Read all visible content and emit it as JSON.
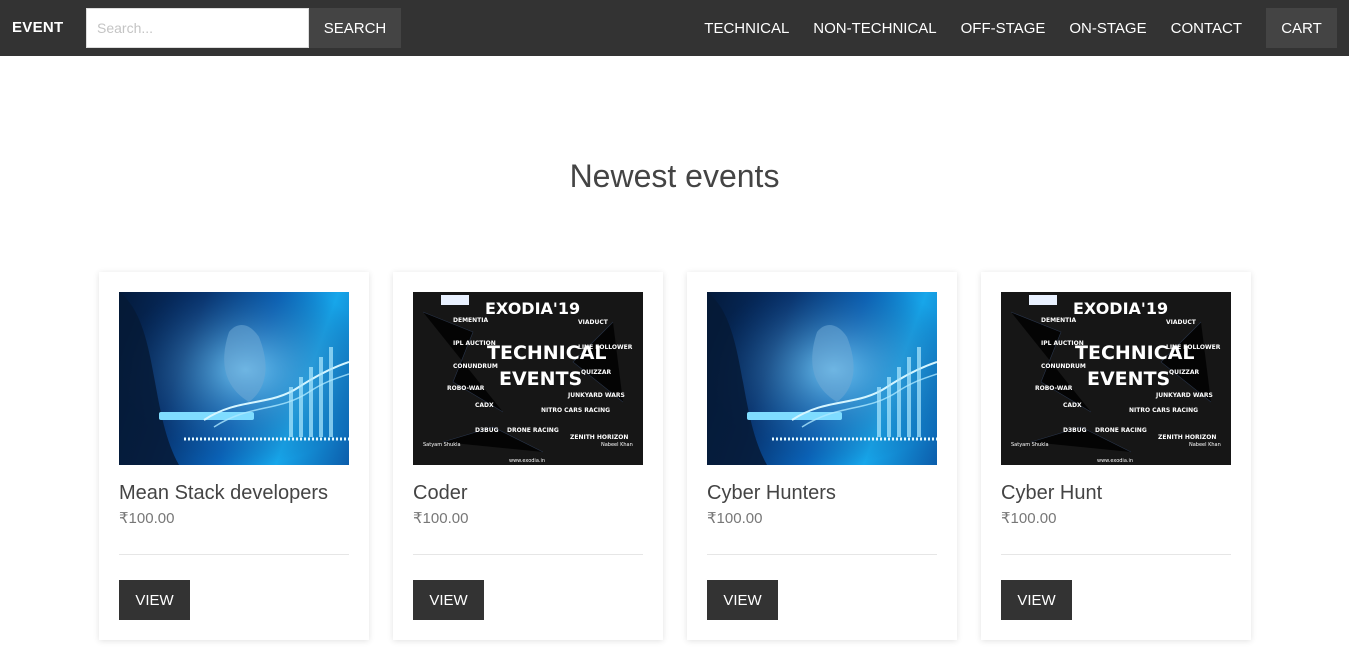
{
  "navbar": {
    "brand": "EVENT",
    "search": {
      "placeholder": "Search...",
      "value": "",
      "button_label": "SEARCH"
    },
    "links": [
      "TECHNICAL",
      "NON-TECHNICAL",
      "OFF-STAGE",
      "ON-STAGE",
      "CONTACT"
    ],
    "cart_label": "CART"
  },
  "main": {
    "title": "Newest events",
    "events": [
      {
        "title": "Mean Stack developers",
        "price": "₹100.00",
        "image": "cyber-tech-image",
        "button_label": "VIEW"
      },
      {
        "title": "Coder",
        "price": "₹100.00",
        "image": "exodia-poster-image",
        "button_label": "VIEW"
      },
      {
        "title": "Cyber Hunters",
        "price": "₹100.00",
        "image": "cyber-tech-image",
        "button_label": "VIEW"
      },
      {
        "title": "Cyber Hunt",
        "price": "₹100.00",
        "image": "exodia-poster-image",
        "button_label": "VIEW"
      }
    ]
  },
  "poster": {
    "headline": "EXODIA'19",
    "title_line1": "TECHNICAL",
    "title_line2": "EVENTS",
    "left_items": [
      "DEMENTIA",
      "IPL AUCTION",
      "CONUNDRUM",
      "ROBO-WAR",
      "CADX",
      "D3BUG"
    ],
    "right_items": [
      "VIADUCT",
      "LINE FOLLOWER",
      "QUIZZAR",
      "JUNKYARD WARS",
      "NITRO CARS RACING",
      "DRONE RACING",
      "ZENITH HORIZON"
    ],
    "website": "www.exodia.in",
    "contact_left": "Satyam Shukla",
    "contact_right": "Nabeel Khan"
  },
  "colors": {
    "navbar_bg": "#333333",
    "button_bg": "#444444",
    "view_button_bg": "#333333",
    "poster_accent": "#ffffff"
  }
}
